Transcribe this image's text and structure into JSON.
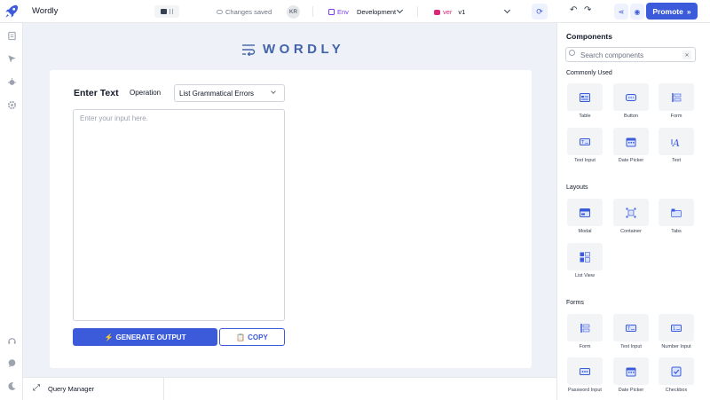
{
  "app": {
    "name": "Wordly"
  },
  "header": {
    "save_status": "Changes saved",
    "user_initials": "KR",
    "env_label": "Env",
    "env_value": "Development",
    "ver_label": "ver",
    "ver_value": "v1",
    "promote_label": "Promote"
  },
  "canvas": {
    "brand": "WORDLY",
    "enter_text_label": "Enter Text",
    "operation_label": "Operation",
    "operation_value": "List Grammatical Errors",
    "input_placeholder": "Enter your input here.",
    "generate_label": "GENERATE OUTPUT",
    "copy_label": "COPY"
  },
  "bottom": {
    "query_manager": "Query Manager"
  },
  "components": {
    "title": "Components",
    "search_placeholder": "Search components",
    "sections": [
      {
        "title": "Commonly Used",
        "items": [
          "Table",
          "Button",
          "Form",
          "Text Input",
          "Date Picker",
          "Text"
        ]
      },
      {
        "title": "Layouts",
        "items": [
          "Modal",
          "Container",
          "Tabs",
          "List View"
        ]
      },
      {
        "title": "Forms",
        "items": [
          "Form",
          "Text Input",
          "Number Input",
          "Password Input",
          "Date Picker",
          "Checkbox"
        ]
      }
    ]
  },
  "colors": {
    "primary": "#3b5bdb",
    "env": "#7c3aed",
    "version": "#db2777",
    "canvas_bg": "#eef1f8"
  }
}
